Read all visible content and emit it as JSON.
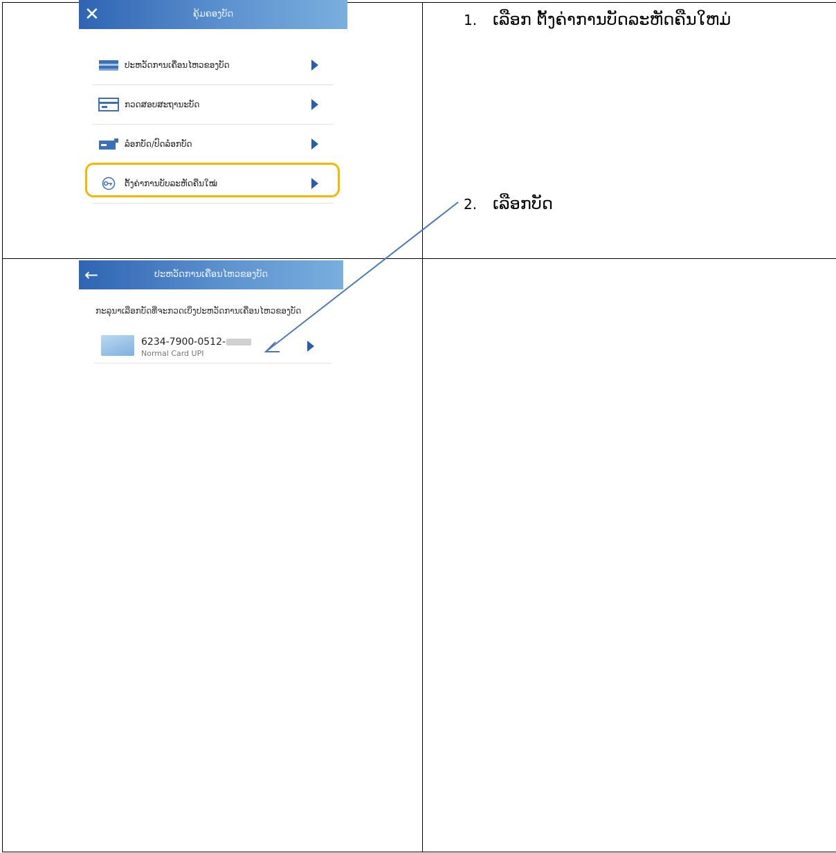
{
  "steps": [
    {
      "number": "1.",
      "text": "ເລືອກ ຕັ້ງຄ່າການບັດລະຫັດຄືນໃຫມ່"
    },
    {
      "number": "2.",
      "text": "ເລືອກບັດ"
    }
  ],
  "screen1": {
    "title": "ຄຸ້ມຄອງບັດ",
    "close_icon": "close-icon",
    "menu": [
      {
        "label": "ປະຫວັດການເຄື່ອນໄຫວຂອງບັດ",
        "icon": "card-stack-icon"
      },
      {
        "label": "ກວດສອບສະຖານະບັດ",
        "icon": "card-scan-icon"
      },
      {
        "label": "ລ໋ອກບັດ/ປົດລ໋ອກບັດ",
        "icon": "card-lock-icon"
      },
      {
        "label": "ຕັ້ງຄ່າການບັບລະຫັດຄືນໃໝ່",
        "icon": "key-reset-icon"
      }
    ],
    "highlight_color": "#f5b700"
  },
  "screen2": {
    "title": "ປະຫວັດການເຄື່ອນໄຫວຂອງບັດ",
    "back_icon": "back-arrow-icon",
    "instruction": "ກະລຸນາເລືອກບັດທີ່ຈະກວດເບິ່ງປະຫວັດການເຄື່ອນໄຫວຂອງບັດ",
    "card": {
      "number": "6234-7900-0512-",
      "type": "Normal Card UPI"
    }
  },
  "colors": {
    "appbar_start": "#2f64b3",
    "appbar_end": "#7aaede",
    "arrow": "#2b5ea8",
    "annotation_line": "#4a78b8"
  }
}
